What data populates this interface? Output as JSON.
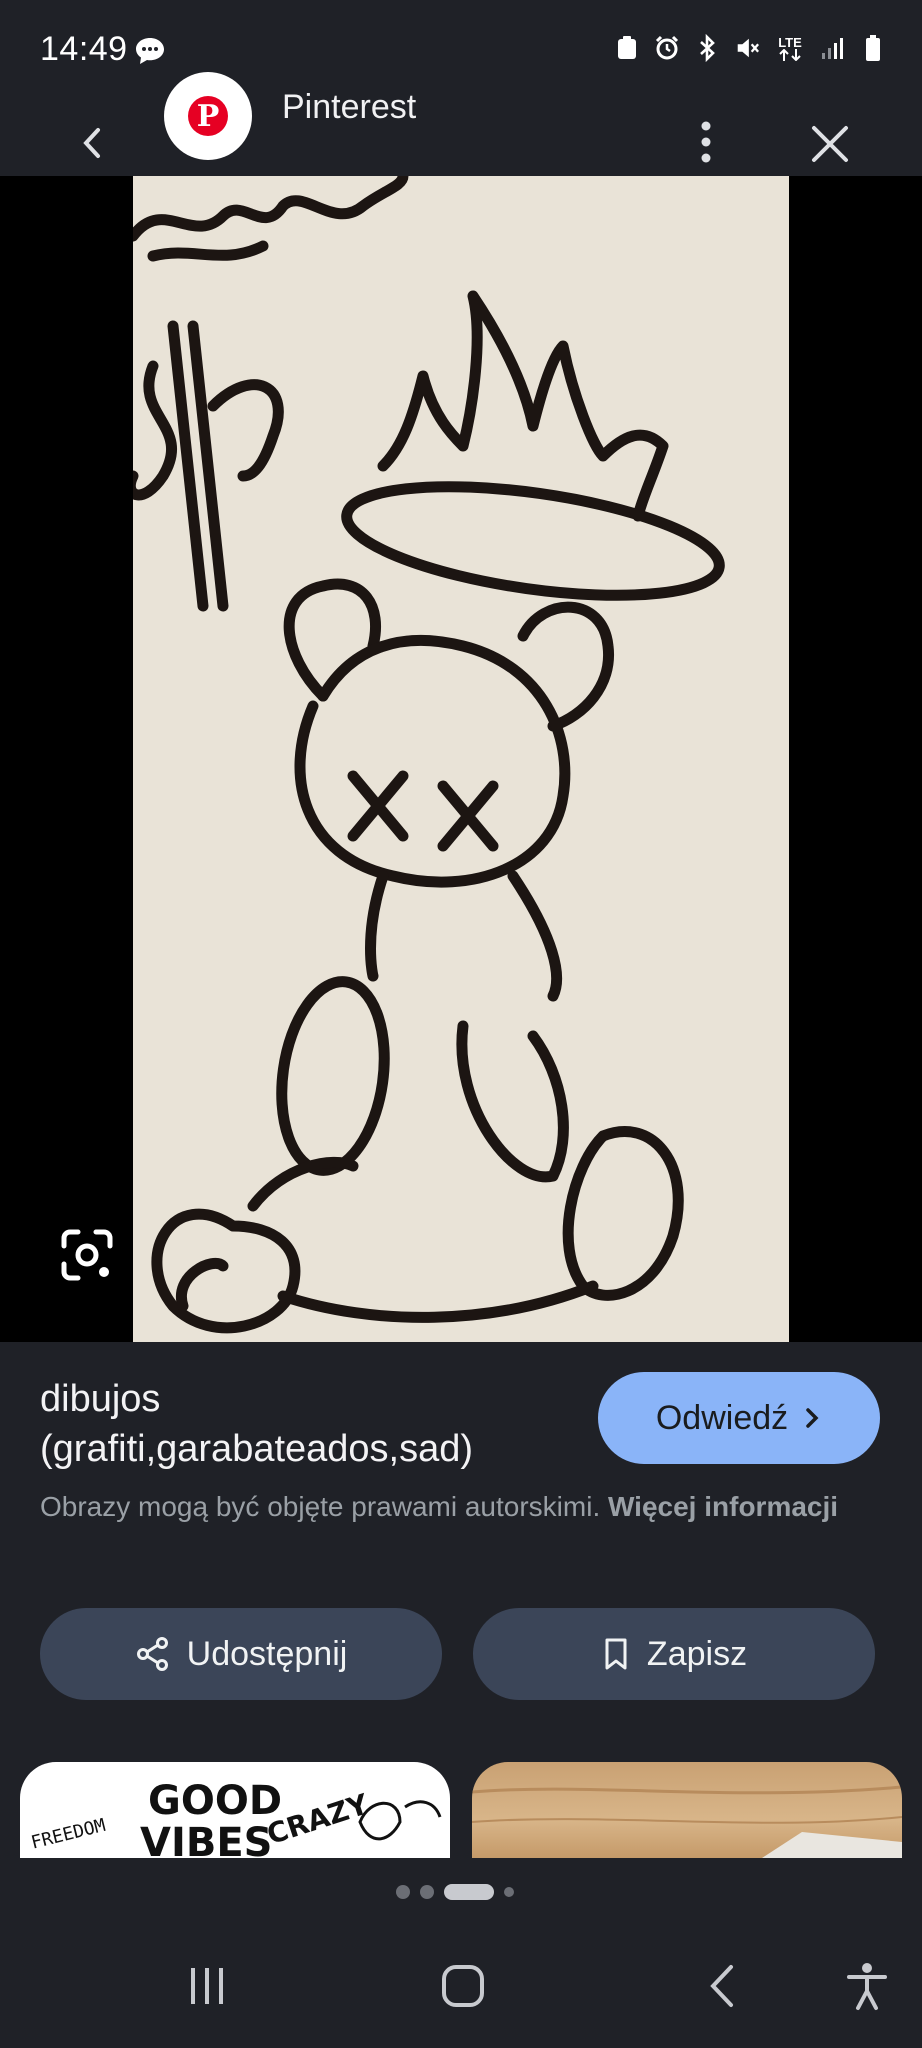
{
  "status": {
    "time": "14:49",
    "icons": [
      "chat-icon",
      "recycle-icon",
      "alarm-icon",
      "bluetooth-icon",
      "mute-icon",
      "lte-icon",
      "signal-icon",
      "battery-icon"
    ],
    "lte_label": "LTE"
  },
  "header": {
    "site_name": "Pinterest",
    "avatar_letter": "P"
  },
  "result": {
    "title": "dibujos (grafiti,garabateados,sad)",
    "visit_label": "Odwiedź",
    "copyright_text": "Obrazy mogą być objęte prawami autorskimi.",
    "more_info_label": "Więcej informacji"
  },
  "actions": {
    "share_label": "Udostępnij",
    "save_label": "Zapisz"
  },
  "related": {
    "thumb_1_lines": [
      "GOOD",
      "VIBES",
      "CRAZY",
      "FREEDOM"
    ]
  },
  "colors": {
    "background": "#1f2127",
    "visit_button": "#8ab4f8",
    "action_button": "#3b4558",
    "pinterest_red": "#e60023"
  }
}
